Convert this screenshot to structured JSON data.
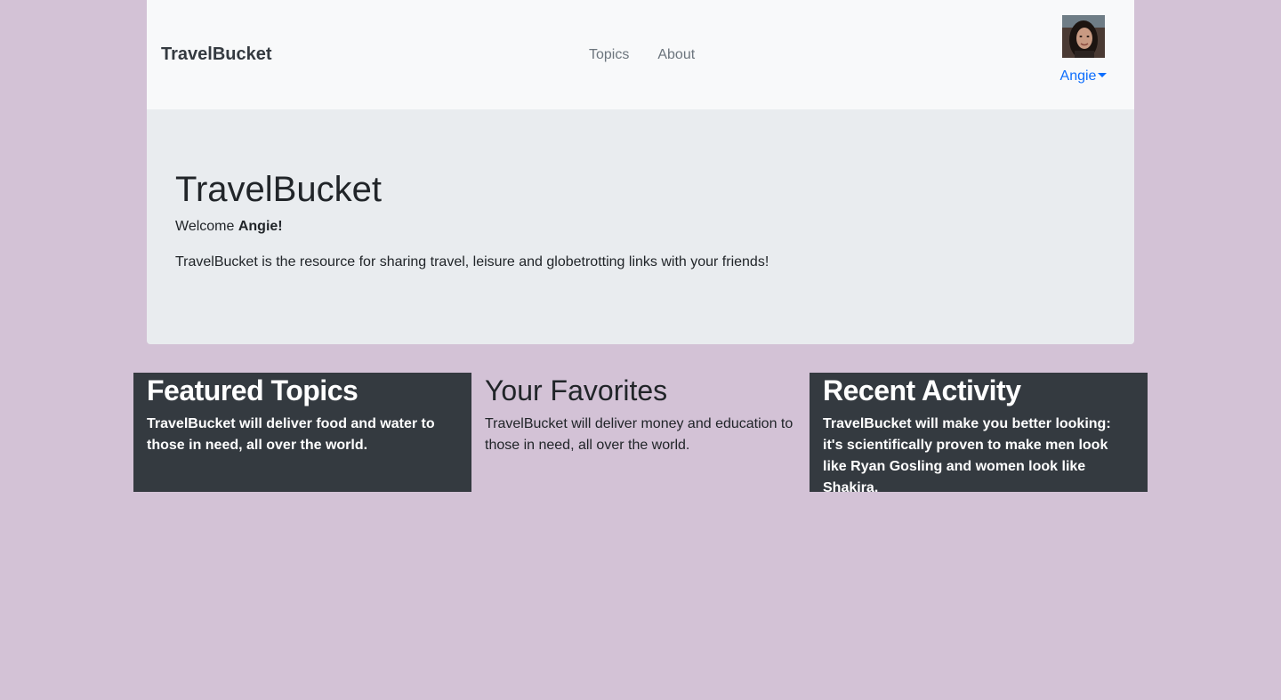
{
  "navbar": {
    "brand": "TravelBucket",
    "links": [
      "Topics",
      "About"
    ],
    "user": {
      "name": "Angie",
      "avatar_icon": "user-avatar-photo"
    }
  },
  "jumbotron": {
    "title": "TravelBucket",
    "welcome_prefix": "Welcome ",
    "welcome_name": "Angie!",
    "lead": "TravelBucket is the resource for sharing travel, leisure and globetrotting links with your friends!"
  },
  "columns": [
    {
      "title": "Featured Topics",
      "text": "TravelBucket will deliver food and water to those in need, all over the world."
    },
    {
      "title": "Your Favorites",
      "text": "TravelBucket will deliver money and education to those in need, all over the world."
    },
    {
      "title": "Recent Activity",
      "text": "TravelBucket will make you better looking: it's scientifically proven to make men look like Ryan Gosling and women look like Shakira."
    }
  ],
  "colors": {
    "page_background": "#d3c2d6",
    "navbar_background": "#f8f9fa",
    "jumbotron_background": "#e9ecef",
    "dark_card": "#343a40",
    "link_blue": "#0d6efd"
  }
}
